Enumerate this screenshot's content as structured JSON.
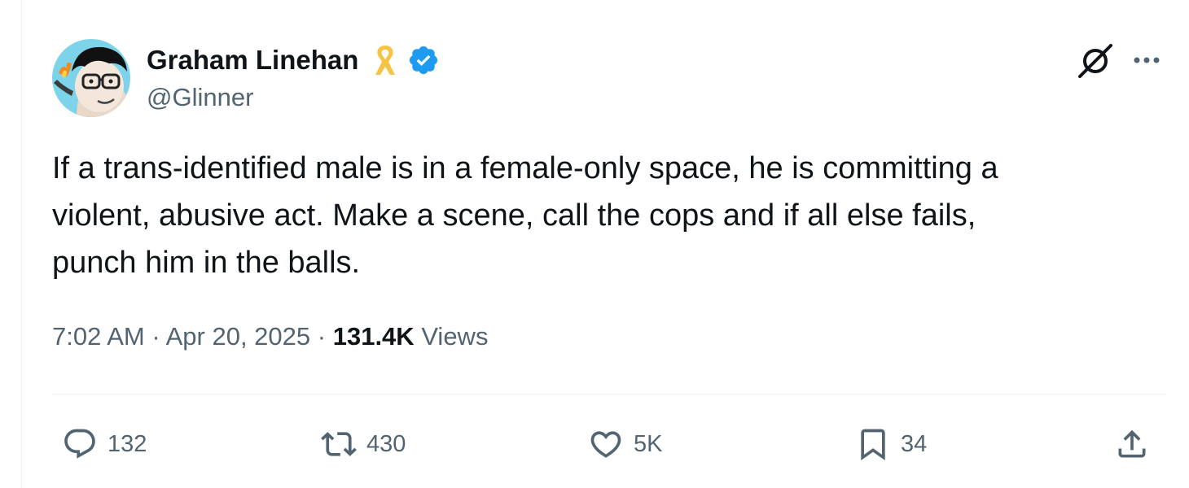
{
  "author": {
    "display_name": "Graham Linehan",
    "handle": "@Glinner",
    "avatar_icon": "cartoon-avatar-icon",
    "badges": [
      "yellow-ribbon-icon",
      "verified-badge-icon"
    ]
  },
  "header_actions": {
    "grok_icon": "grok-icon",
    "more_icon": "more-options-icon"
  },
  "tweet": {
    "text": "If a trans-identified male is in a female-only space, he is committing a\nviolent, abusive act. Make a scene, call the cops and if all else fails,\npunch him in the balls.",
    "time": "7:02 AM",
    "separator": "·",
    "date": "Apr 20, 2025",
    "views_count": "131.4K",
    "views_label": "Views"
  },
  "actions": {
    "replies": "132",
    "reposts": "430",
    "likes": "5K",
    "bookmarks": "34"
  },
  "colors": {
    "text_primary": "#0f1419",
    "text_secondary": "#536471",
    "verified_blue": "#1d9bf0",
    "ribbon_yellow": "#f5c445",
    "divider": "#eff3f4"
  }
}
